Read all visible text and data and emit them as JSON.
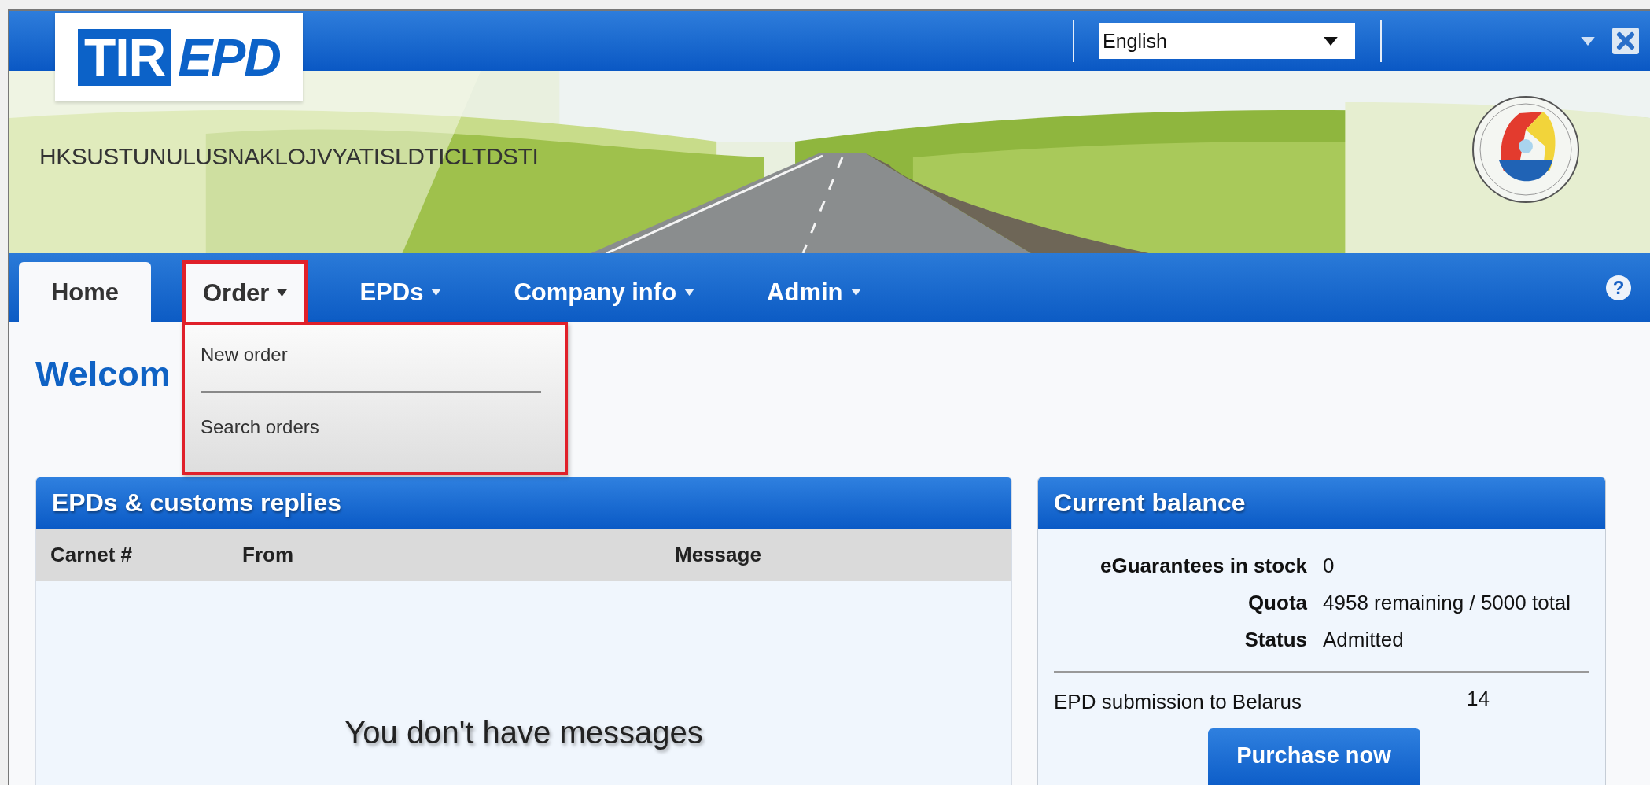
{
  "header": {
    "logo": {
      "part_1": "TIR",
      "part_2": "EPD"
    },
    "language_select": {
      "value": "English"
    },
    "company_name": "HKSUSTUNULUSNAKLOJVYATISLDTICLTDSTI"
  },
  "nav": {
    "tabs": [
      {
        "label": "Home",
        "selected": true,
        "has_menu": false,
        "open": false
      },
      {
        "label": "Order",
        "selected": false,
        "has_menu": true,
        "open": true
      },
      {
        "label": "EPDs",
        "selected": false,
        "has_menu": true,
        "open": false
      },
      {
        "label": "Company info",
        "selected": false,
        "has_menu": true,
        "open": false
      },
      {
        "label": "Admin",
        "selected": false,
        "has_menu": true,
        "open": false
      }
    ]
  },
  "help_button": "?",
  "order_menu": {
    "items": [
      "New order",
      "Search orders"
    ]
  },
  "welcome_heading": "Welcom",
  "replies_panel": {
    "title": "EPDs & customs replies",
    "columns": [
      "Carnet #",
      "From",
      "Message"
    ],
    "empty_message": "You don't have messages"
  },
  "balance_panel": {
    "title": "Current balance",
    "rows": [
      {
        "label": "eGuarantees in stock",
        "value": "0"
      },
      {
        "label": "Quota",
        "value": "4958 remaining / 5000 total"
      },
      {
        "label": "Status",
        "value": "Admitted"
      }
    ],
    "submission": {
      "label": "EPD submission to Belarus",
      "value": "14"
    },
    "button": "Purchase now"
  }
}
